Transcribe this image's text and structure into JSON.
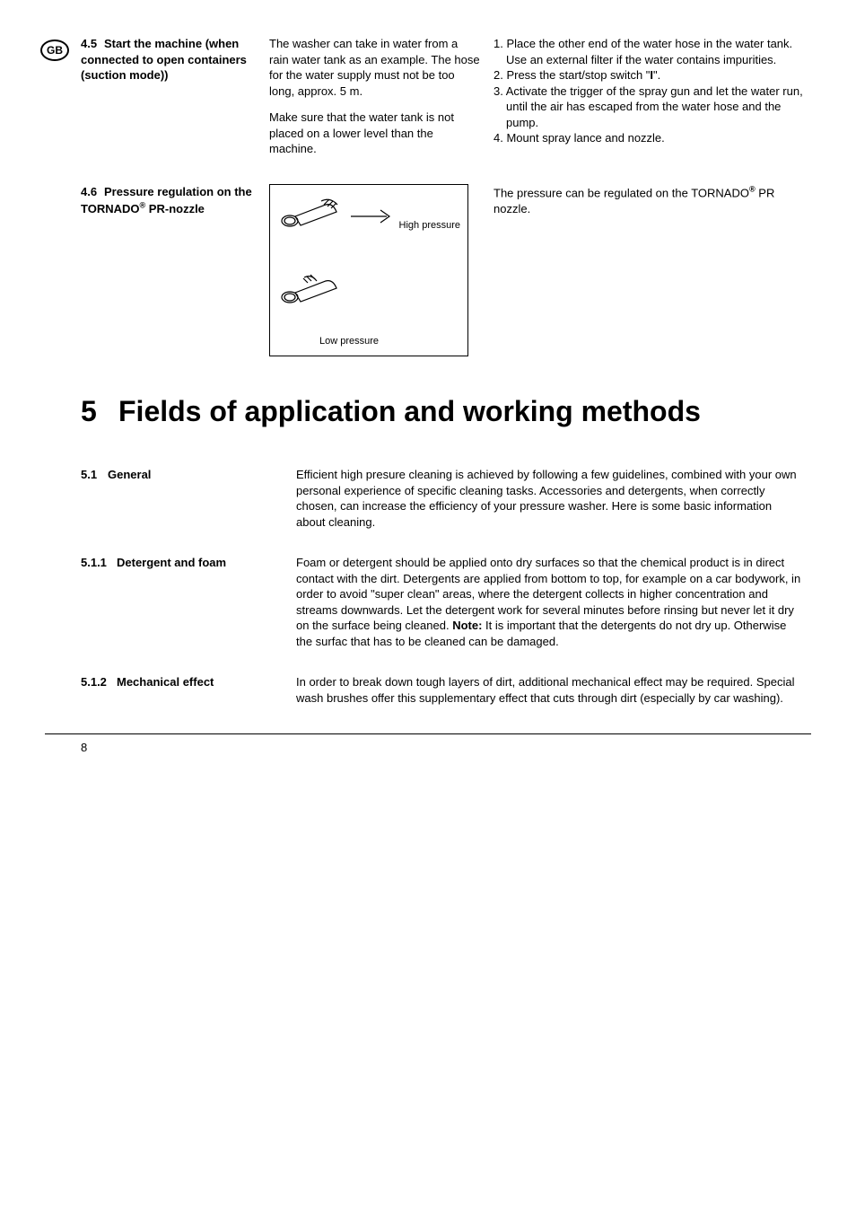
{
  "badge": "GB",
  "sec45": {
    "num": "4.5",
    "title": "Start the machine (when connected to open containers (suction mode))",
    "mid_p1": "The washer can take in water from a rain water tank as an example. The hose for the water supply must not be too long, approx. 5 m.",
    "mid_p2": "Make sure that the water tank is not placed on a lower level than the machine.",
    "r1": "1. Place the other end of the water hose in the water tank. Use an external filter if the water contains impurities.",
    "r2a": "2. Press the start/stop switch \"",
    "r2b": "I",
    "r2c": "\".",
    "r3": "3. Activate the trigger of the spray gun and let the water run, until the air has escaped from the water hose and the pump.",
    "r4": "4. Mount spray lance and nozzle."
  },
  "sec46": {
    "num": "4.6",
    "title_a": "Pressure regulation on the TORNADO",
    "title_b": " PR-nozzle",
    "high": "High pressure",
    "low": "Low pressure",
    "right_a": "The pressure can be regulated on the TORNADO",
    "right_b": " PR nozzle."
  },
  "chapter": {
    "num": "5",
    "title": "Fields of application and working methods"
  },
  "sec51": {
    "num": "5.1",
    "title": "General",
    "body": "Efficient high presure cleaning is achieved by following a few guidelines, combined with your own personal experience of specific cleaning tasks. Accessories and detergents, when correctly chosen, can increase the efficiency of your pressure washer. Here is some basic information about cleaning."
  },
  "sec511": {
    "num": "5.1.1",
    "title": "Detergent and foam",
    "body_a": "Foam or detergent should be applied onto dry surfaces so that the chemical product is in direct contact with the dirt. Detergents are applied from bottom to top, for example on a car bodywork, in order to avoid \"super clean\" areas, where the detergent collects in higher concentration and streams downwards. Let the detergent work for several minutes before rinsing but never let it dry on the surface being cleaned. ",
    "note": "Note:",
    "body_b": " It is important that the detergents do not dry up. Otherwise the surfac that has to be cleaned can be damaged."
  },
  "sec512": {
    "num": "5.1.2",
    "title": "Mechanical effect",
    "body": "In order to break down tough layers of dirt, additional mechanical effect may be required. Special wash brushes offer this supplementary effect that cuts through dirt (especially by car washing)."
  },
  "page": "8"
}
